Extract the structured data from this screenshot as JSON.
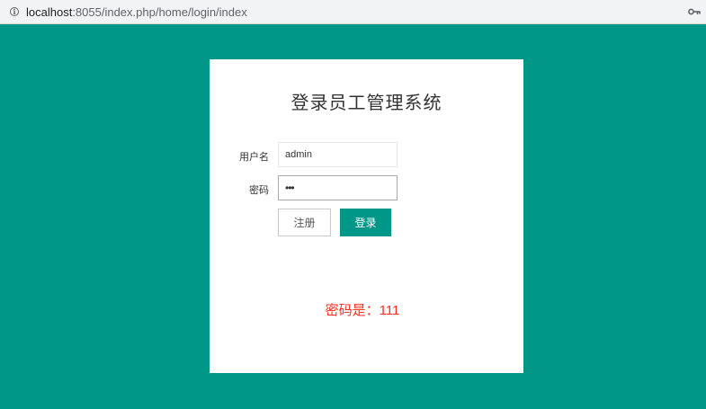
{
  "browser": {
    "url_host": "localhost",
    "url_rest": ":8055/index.php/home/login/index",
    "info_icon": "info-icon",
    "key_icon": "key-icon"
  },
  "login": {
    "title": "登录员工管理系统",
    "username_label": "用户名",
    "username_value": "admin",
    "password_label": "密码",
    "password_value": "111",
    "register_label": "注册",
    "login_label": "登录",
    "hint": "密码是：111"
  },
  "colors": {
    "background": "#009688",
    "primary_button": "#009688",
    "hint_text": "#ff2d20"
  }
}
